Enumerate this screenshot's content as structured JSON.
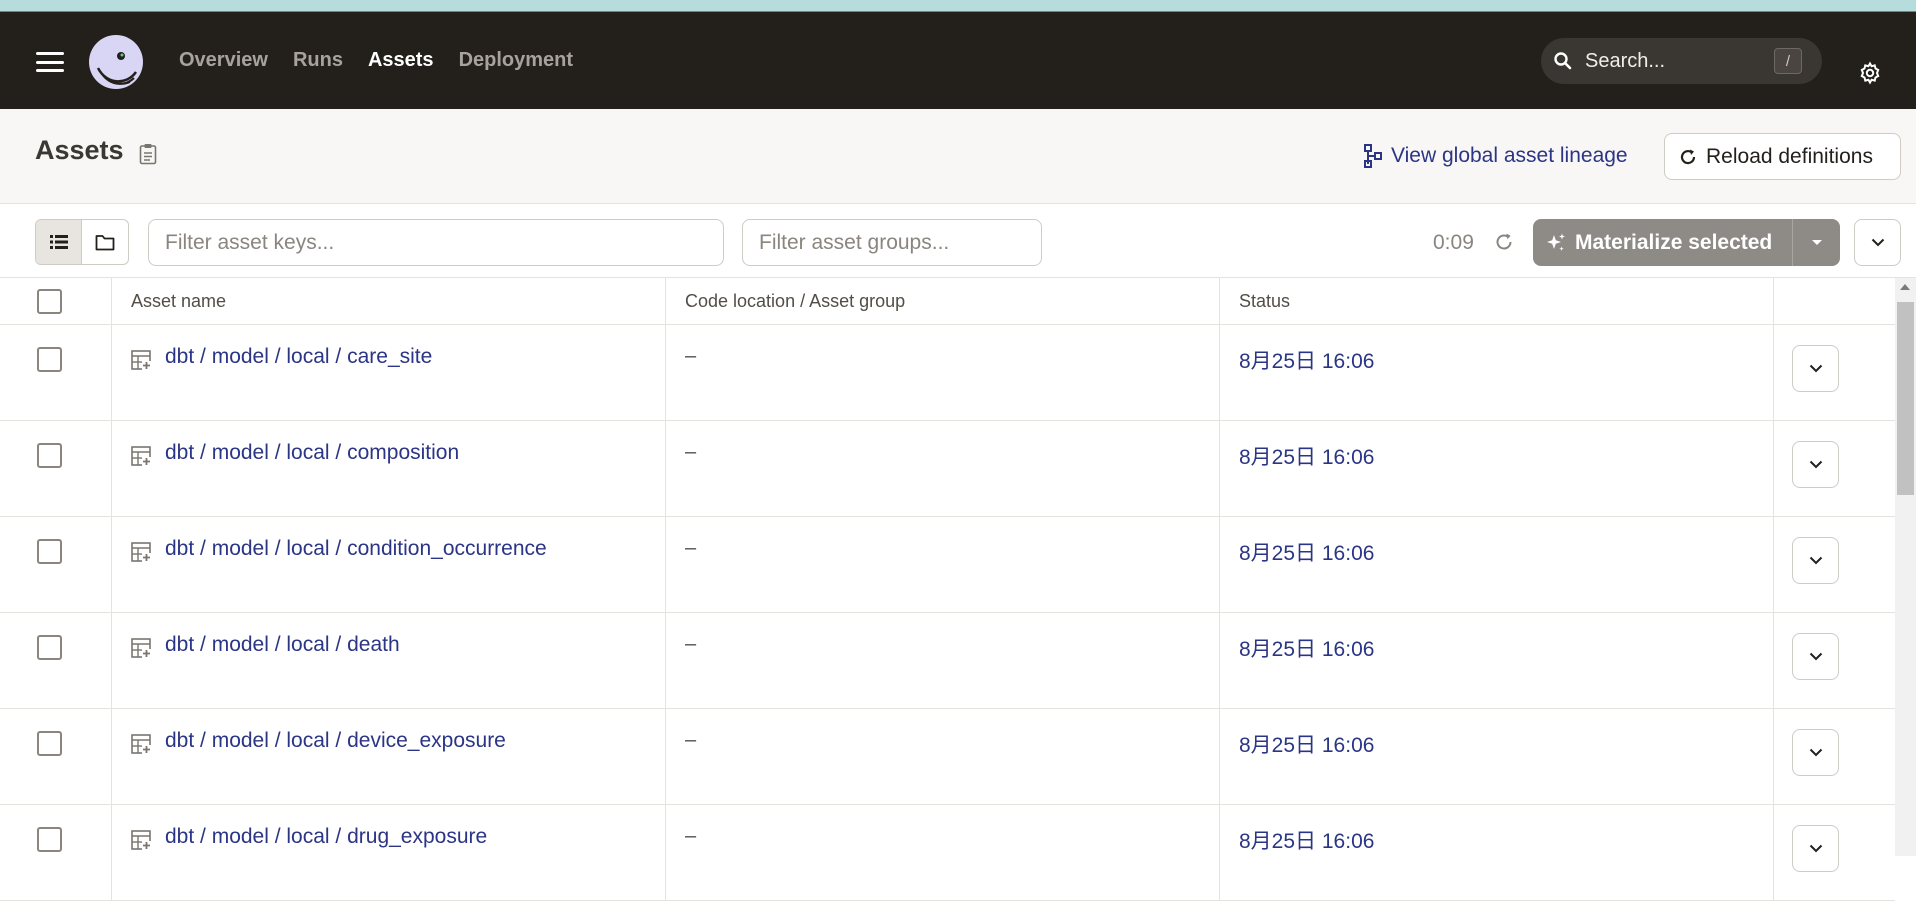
{
  "nav": {
    "links": [
      "Overview",
      "Runs",
      "Assets",
      "Deployment"
    ],
    "active": "Assets",
    "search_placeholder": "Search...",
    "search_shortcut": "/"
  },
  "header": {
    "title": "Assets",
    "lineage_label": "View global asset lineage",
    "reload_label": "Reload definitions"
  },
  "toolbar": {
    "filter_keys_placeholder": "Filter asset keys...",
    "filter_groups_placeholder": "Filter asset groups...",
    "timer": "0:09",
    "materialize_label": "Materialize selected"
  },
  "table": {
    "columns": [
      "Asset name",
      "Code location / Asset group",
      "Status"
    ],
    "rows": [
      {
        "name": "dbt / model / local / care_site",
        "location": "–",
        "status": "8月25日 16:06"
      },
      {
        "name": "dbt / model / local / composition",
        "location": "–",
        "status": "8月25日 16:06"
      },
      {
        "name": "dbt / model / local / condition_occurrence",
        "location": "–",
        "status": "8月25日 16:06"
      },
      {
        "name": "dbt / model / local / death",
        "location": "–",
        "status": "8月25日 16:06"
      },
      {
        "name": "dbt / model / local / device_exposure",
        "location": "–",
        "status": "8月25日 16:06"
      },
      {
        "name": "dbt / model / local / drug_exposure",
        "location": "–",
        "status": "8月25日 16:06"
      }
    ]
  },
  "icons": {
    "menu": "hamburger-menu-icon",
    "logo": "dagster-logo",
    "search": "search-icon",
    "settings": "gear-icon",
    "clipboard": "clipboard-icon",
    "lineage": "lineage-icon",
    "reload": "reload-icon",
    "list_view": "list-view-icon",
    "folder_view": "folder-view-icon",
    "refresh": "refresh-icon",
    "sparkle": "sparkle-icon",
    "chevron": "chevron-down-icon",
    "asset": "table-asset-icon"
  },
  "colors": {
    "navbar": "#231f1b",
    "link": "#2b3585",
    "accent_strip": "#b6dcdc",
    "materialize_button": "#8e8a85"
  }
}
